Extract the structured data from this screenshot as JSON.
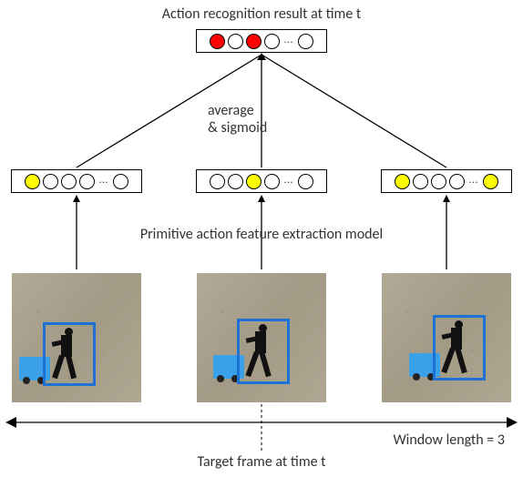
{
  "title": "Action recognition result at time t",
  "merge_label_line1": "average",
  "merge_label_line2": "& sigmoid",
  "model_label": "Primitive action feature extraction model",
  "target_label": "Target frame at time t",
  "window_label": "Window length = 3",
  "result_vector": {
    "pattern": [
      "red",
      "white",
      "red",
      "white",
      "dots",
      "white"
    ]
  },
  "feature_vectors": {
    "left": [
      "yellow",
      "white",
      "white",
      "white",
      "dots",
      "white"
    ],
    "center": [
      "white",
      "white",
      "yellow",
      "white",
      "dots",
      "white"
    ],
    "right": [
      "yellow",
      "white",
      "white",
      "white",
      "dots",
      "yellow"
    ]
  },
  "frames": {
    "count": 3,
    "positions": [
      "left",
      "center",
      "right"
    ]
  },
  "chart_data": {
    "type": "diagram",
    "window_length": 3,
    "aggregation": [
      "average",
      "sigmoid"
    ],
    "model": "Primitive action feature extraction model",
    "frames_shown": 3,
    "target_frame_index": 1,
    "result_vector_active_indices": [
      0,
      2
    ],
    "feature_vectors_active_indices": {
      "left": [
        0
      ],
      "center": [
        2
      ],
      "right": [
        0,
        5
      ]
    }
  }
}
